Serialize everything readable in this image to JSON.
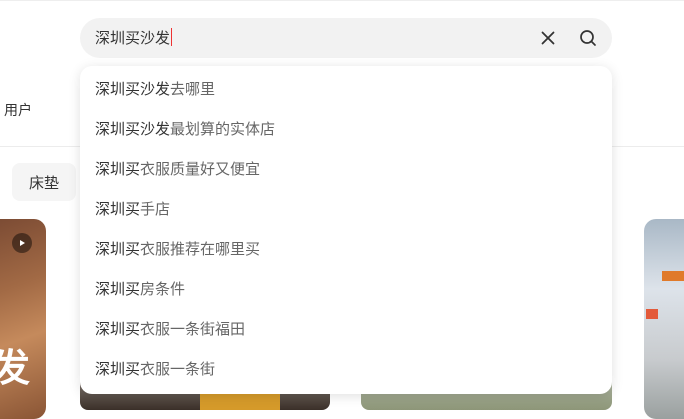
{
  "search": {
    "query": "深圳买沙发",
    "clear_icon": "close-icon",
    "search_icon": "search-icon"
  },
  "background": {
    "tab_label": "用户",
    "chip_label": "床垫",
    "card_overlay_text": "发"
  },
  "suggestions": [
    {
      "match": "深圳买沙发",
      "rest": "去哪里"
    },
    {
      "match": "深圳买沙发",
      "rest": "最划算的实体店"
    },
    {
      "match": "深圳买",
      "rest": "衣服质量好又便宜"
    },
    {
      "match": "深圳买",
      "rest": "手店"
    },
    {
      "match": "深圳买",
      "rest": "衣服推荐在哪里买"
    },
    {
      "match": "深圳买",
      "rest": "房条件"
    },
    {
      "match": "深圳买",
      "rest": "衣服一条街福田"
    },
    {
      "match": "深圳买",
      "rest": "衣服一条街"
    }
  ],
  "colors": {
    "search_bg": "#f2f2f2",
    "caret": "#ee3333",
    "match_text": "#333333",
    "rest_text": "#666666"
  }
}
